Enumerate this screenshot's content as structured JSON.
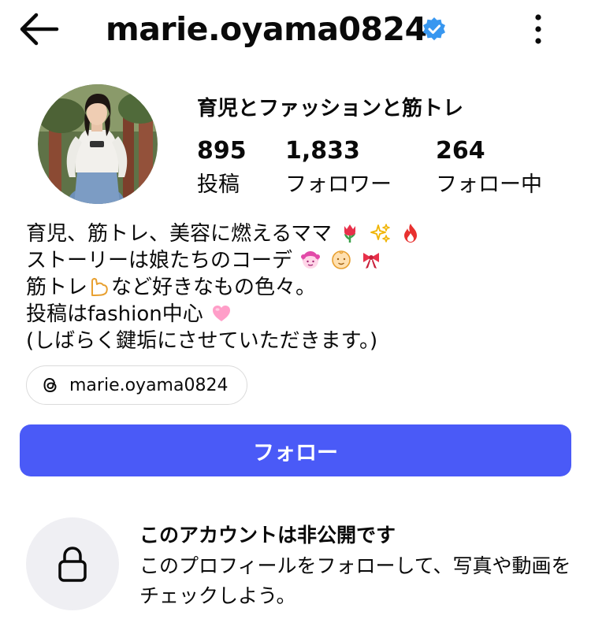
{
  "header": {
    "back_icon": "arrow-left-icon",
    "username": "marie.oyama0824",
    "verified_icon": "verified-badge-icon",
    "verified_color": "#3897f0",
    "more_icon": "more-vertical-icon"
  },
  "profile": {
    "avatar_icon": "profile-avatar",
    "display_name": "育児とファッションと筋トレ",
    "stats": [
      {
        "value": "895",
        "label": "投稿"
      },
      {
        "value": "1,833",
        "label": "フォロワー"
      },
      {
        "value": "264",
        "label": "フォロー中"
      }
    ]
  },
  "bio": {
    "lines": [
      {
        "text": "育児、筋トレ、美容に燃えるママ",
        "emojis": [
          "tulip-emoji",
          "sparkles-emoji",
          "fire-emoji"
        ]
      },
      {
        "text": "ストーリーは娘たちのコーデ",
        "emojis": [
          "girl-emoji",
          "baby-emoji",
          "ribbon-emoji"
        ]
      },
      {
        "text_before": "筋トレ",
        "emoji": "flexed-biceps-emoji",
        "text_after": "など好きなもの色々。"
      },
      {
        "text": "投稿はfashion中心",
        "emojis": [
          "pink-heart-emoji"
        ]
      },
      {
        "text": "(しばらく鍵垢にさせていただきます。)"
      }
    ]
  },
  "threads_link": {
    "icon": "threads-icon",
    "label": "marie.oyama0824"
  },
  "follow_button": {
    "label": "フォロー",
    "color": "#4a5af7"
  },
  "private_notice": {
    "icon": "lock-icon",
    "title": "このアカウントは非公開です",
    "description": "このプロフィールをフォローして、写真や動画をチェックしよう。"
  }
}
